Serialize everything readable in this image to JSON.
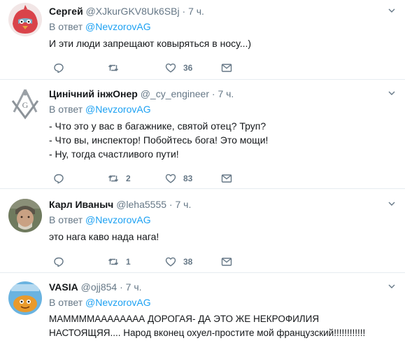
{
  "tweets": [
    {
      "name": "Сергей",
      "handle": "@XJkurGKV8Uk6SBj",
      "time": "7 ч.",
      "reply_prefix": "В ответ",
      "reply_to": "@NevzorovAG",
      "lines": [
        "И эти люди запрещают ковыряться в носу...)"
      ],
      "retweets": "",
      "likes": "36",
      "avatar": "angry-bird-avatar"
    },
    {
      "name": "Цинічний інжОнер",
      "handle": "@_cy_engineer",
      "time": "7 ч.",
      "reply_prefix": "В ответ",
      "reply_to": "@NevzorovAG",
      "lines": [
        "- Что это у вас в багажнике, святой отец? Труп?",
        "- Что вы, инспектор! Побойтесь бога! Это мощи!",
        "- Ну, тогда счастливого пути!"
      ],
      "retweets": "2",
      "likes": "83",
      "avatar": "masonic-emblem-avatar"
    },
    {
      "name": "Карл Иваныч",
      "handle": "@leha5555",
      "time": "7 ч.",
      "reply_prefix": "В ответ",
      "reply_to": "@NevzorovAG",
      "lines": [
        "это нага каво нада нага!"
      ],
      "retweets": "1",
      "likes": "38",
      "avatar": "man-photo-avatar"
    },
    {
      "name": "VASIA",
      "handle": "@ojj854",
      "time": "7 ч.",
      "reply_prefix": "В ответ",
      "reply_to": "@NevzorovAG",
      "lines": [
        "МАММММАААААААА ДОРОГАЯ- ДА ЭТО ЖЕ НЕКРОФИЛИЯ",
        "НАСТОЯЩЯЯ.... Народ вконец охуел-простите мой французский!!!!!!!!!!!!"
      ],
      "retweets": "",
      "likes": "",
      "avatar": "cartoon-pancake-avatar"
    }
  ],
  "icons": {
    "reply": "reply-icon",
    "retweet": "retweet-icon",
    "like": "heart-icon",
    "dm": "envelope-icon",
    "menu": "chevron-down-icon"
  },
  "colors": {
    "link": "#1da1f2",
    "muted": "#657786",
    "text": "#14171a",
    "divider": "#e6ecf0"
  }
}
